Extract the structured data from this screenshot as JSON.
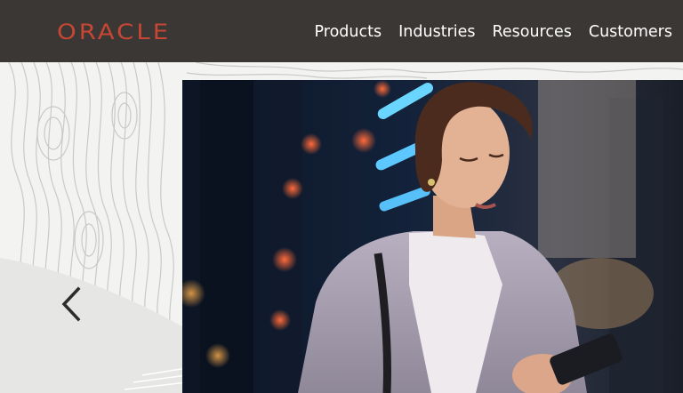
{
  "header": {
    "logo": "ORACLE",
    "nav": [
      "Products",
      "Industries",
      "Resources",
      "Customers"
    ]
  },
  "carousel": {
    "prev_icon": "chevron-left-icon",
    "slide_image": "woman-using-smartphone-city-night"
  },
  "colors": {
    "header_bg": "#3b3734",
    "brand_red": "#c74634",
    "nav_text": "#ffffff",
    "page_bg": "#f2f2f0"
  }
}
